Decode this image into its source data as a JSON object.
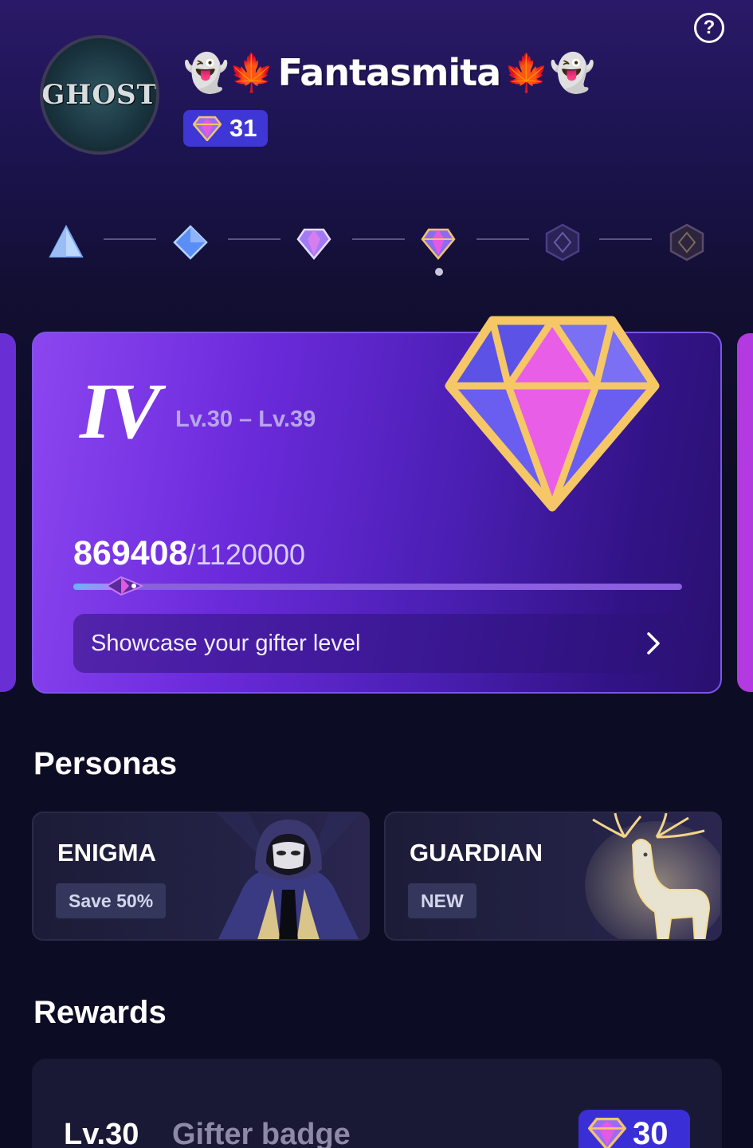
{
  "help": {
    "icon": "question-icon"
  },
  "profile": {
    "avatar_text": "GHOST",
    "name_prefix_emoji": "👻🍁",
    "name": "Fantasmita",
    "name_suffix_emoji": "🍁👻",
    "level_badge": "31"
  },
  "tiers": [
    {
      "name": "tier-1",
      "state": "unlocked"
    },
    {
      "name": "tier-2",
      "state": "unlocked"
    },
    {
      "name": "tier-3",
      "state": "unlocked"
    },
    {
      "name": "tier-4",
      "state": "current"
    },
    {
      "name": "tier-5",
      "state": "locked"
    },
    {
      "name": "tier-6",
      "state": "locked"
    }
  ],
  "level_card": {
    "tier_numeral": "IV",
    "level_range": "Lv.30 – Lv.39",
    "current_points": "869408",
    "total_points": "/1120000",
    "progress_fraction": 0.07,
    "showcase_label": "Showcase your gifter level"
  },
  "personas": {
    "title": "Personas",
    "items": [
      {
        "name": "ENIGMA",
        "tag": "Save 50%"
      },
      {
        "name": "GUARDIAN",
        "tag": "NEW"
      }
    ]
  },
  "rewards": {
    "title": "Rewards",
    "first": {
      "level": "Lv.30",
      "name": "Gifter badge",
      "badge": "30"
    }
  },
  "colors": {
    "accent": "#3f36d6",
    "card_start": "#8c46f0",
    "card_end": "#2a1070",
    "background": "#0d0c25"
  }
}
